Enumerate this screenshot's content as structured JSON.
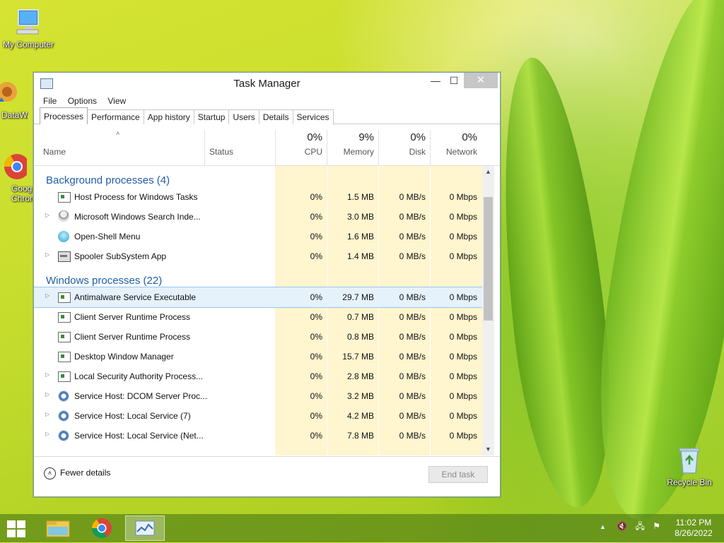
{
  "desktop": {
    "icons": [
      {
        "label": "My Computer"
      },
      {
        "label": "DataWa"
      },
      {
        "label": "Goog Chrom"
      },
      {
        "label": "Recycle Bin"
      }
    ]
  },
  "window": {
    "title": "Task Manager",
    "controls": {
      "minimize": "—",
      "maximize": "☐",
      "close": "✕"
    },
    "menu": [
      "File",
      "Options",
      "View"
    ],
    "tabs": [
      "Processes",
      "Performance",
      "App history",
      "Startup",
      "Users",
      "Details",
      "Services"
    ],
    "active_tab": "Processes",
    "columns": {
      "name": "Name",
      "status": "Status",
      "cpu": {
        "pct": "0%",
        "label": "CPU"
      },
      "memory": {
        "pct": "9%",
        "label": "Memory"
      },
      "disk": {
        "pct": "0%",
        "label": "Disk"
      },
      "network": {
        "pct": "0%",
        "label": "Network"
      }
    },
    "groups": [
      {
        "label": "Background processes (4)",
        "rows": [
          {
            "name": "Host Process for Windows Tasks",
            "cpu": "0%",
            "mem": "1.5 MB",
            "disk": "0 MB/s",
            "net": "0 Mbps",
            "expand": false,
            "icon": "window"
          },
          {
            "name": "Microsoft Windows Search Inde...",
            "cpu": "0%",
            "mem": "3.0 MB",
            "disk": "0 MB/s",
            "net": "0 Mbps",
            "expand": true,
            "icon": "search"
          },
          {
            "name": "Open-Shell Menu",
            "cpu": "0%",
            "mem": "1.6 MB",
            "disk": "0 MB/s",
            "net": "0 Mbps",
            "expand": false,
            "icon": "shell"
          },
          {
            "name": "Spooler SubSystem App",
            "cpu": "0%",
            "mem": "1.4 MB",
            "disk": "0 MB/s",
            "net": "0 Mbps",
            "expand": true,
            "icon": "printer"
          }
        ]
      },
      {
        "label": "Windows processes (22)",
        "rows": [
          {
            "name": "Antimalware Service Executable",
            "cpu": "0%",
            "mem": "29.7 MB",
            "disk": "0 MB/s",
            "net": "0 Mbps",
            "expand": true,
            "icon": "window",
            "selected": true
          },
          {
            "name": "Client Server Runtime Process",
            "cpu": "0%",
            "mem": "0.7 MB",
            "disk": "0 MB/s",
            "net": "0 Mbps",
            "expand": false,
            "icon": "window"
          },
          {
            "name": "Client Server Runtime Process",
            "cpu": "0%",
            "mem": "0.8 MB",
            "disk": "0 MB/s",
            "net": "0 Mbps",
            "expand": false,
            "icon": "window"
          },
          {
            "name": "Desktop Window Manager",
            "cpu": "0%",
            "mem": "15.7 MB",
            "disk": "0 MB/s",
            "net": "0 Mbps",
            "expand": false,
            "icon": "window"
          },
          {
            "name": "Local Security Authority Process...",
            "cpu": "0%",
            "mem": "2.8 MB",
            "disk": "0 MB/s",
            "net": "0 Mbps",
            "expand": true,
            "icon": "window"
          },
          {
            "name": "Service Host: DCOM Server Proc...",
            "cpu": "0%",
            "mem": "3.2 MB",
            "disk": "0 MB/s",
            "net": "0 Mbps",
            "expand": true,
            "icon": "gear"
          },
          {
            "name": "Service Host: Local Service (7)",
            "cpu": "0%",
            "mem": "4.2 MB",
            "disk": "0 MB/s",
            "net": "0 Mbps",
            "expand": true,
            "icon": "gear"
          },
          {
            "name": "Service Host: Local Service (Net...",
            "cpu": "0%",
            "mem": "7.8 MB",
            "disk": "0 MB/s",
            "net": "0 Mbps",
            "expand": true,
            "icon": "gear"
          }
        ]
      }
    ],
    "footer": {
      "fewer_details": "Fewer details",
      "end_task": "End task"
    }
  },
  "taskbar": {
    "clock_time": "11:02 PM",
    "clock_date": "8/26/2022"
  },
  "colors": {
    "group_header": "#1f5da8",
    "column_highlight": "#fff5cf",
    "selection": "#e5f1fb"
  }
}
